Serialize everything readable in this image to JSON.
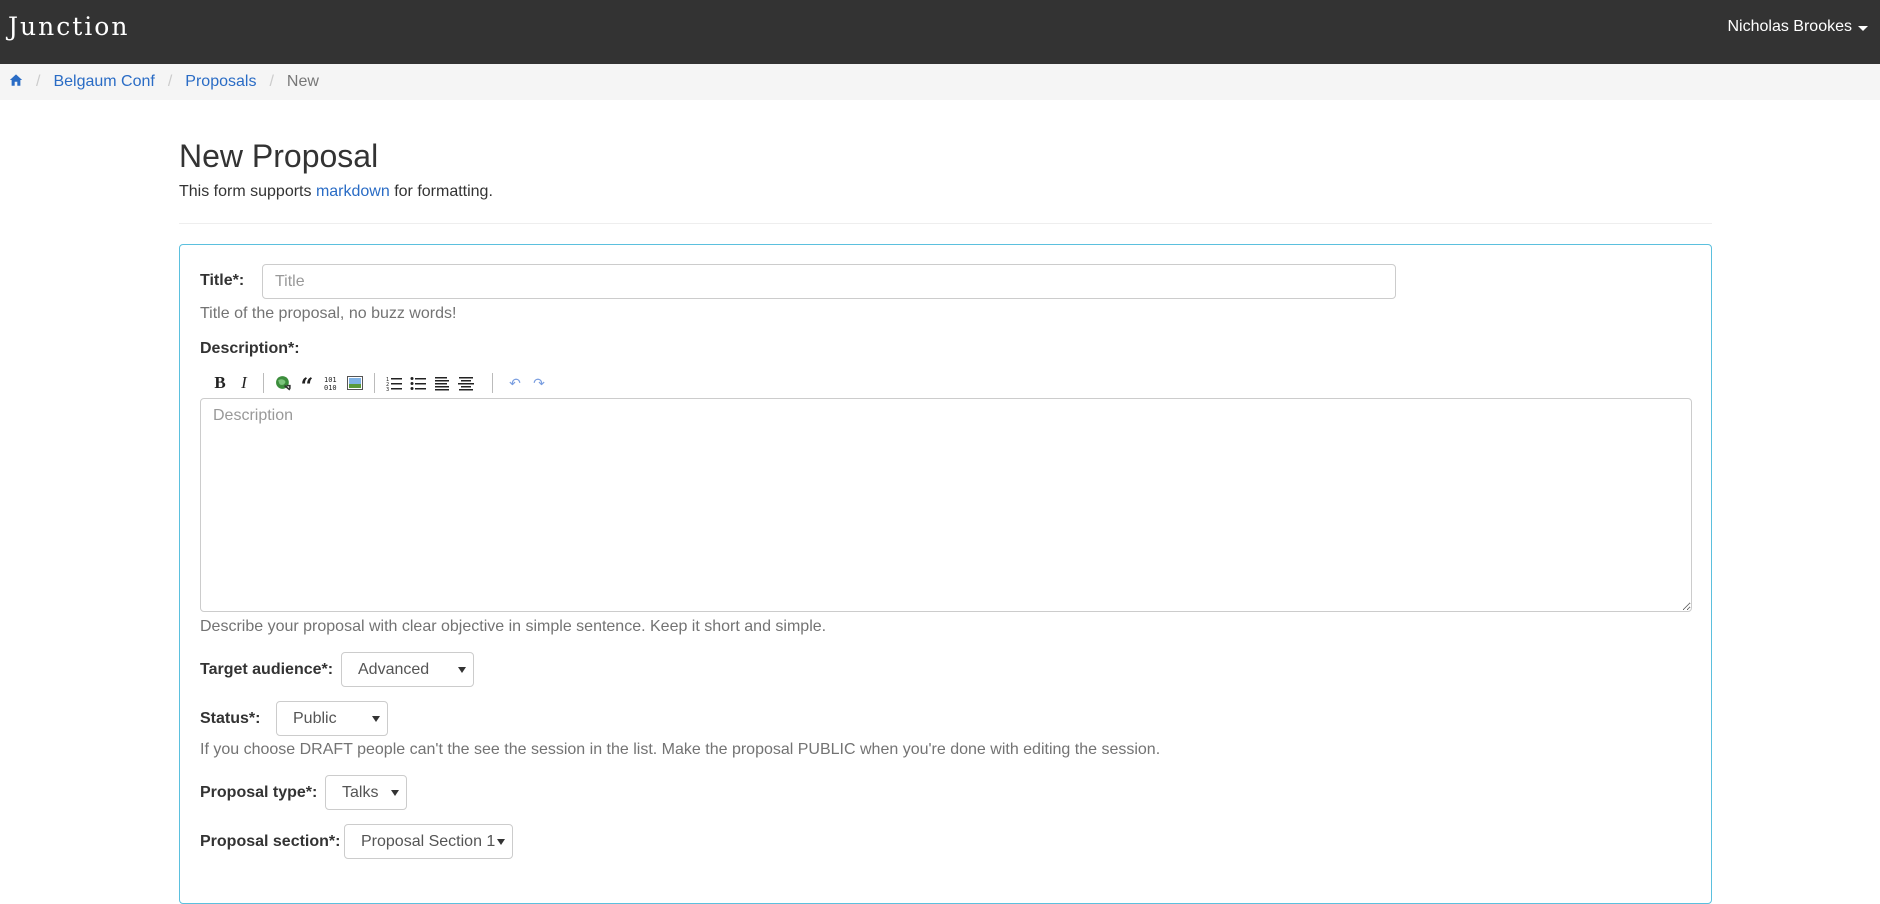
{
  "nav": {
    "brand": "Junction",
    "user_name": "Nicholas Brookes"
  },
  "breadcrumb": {
    "home_icon": "home-icon",
    "items": [
      "Belgaum Conf",
      "Proposals"
    ],
    "active": "New"
  },
  "header": {
    "title": "New Proposal",
    "sub_prefix": "This form supports ",
    "sub_link": "markdown",
    "sub_suffix": " for formatting."
  },
  "form": {
    "title_label": "Title*:",
    "title_placeholder": "Title",
    "title_help": "Title of the proposal, no buzz words!",
    "description_label": "Description*:",
    "description_placeholder": "Description",
    "description_help": "Describe your proposal with clear objective in simple sentence. Keep it short and simple.",
    "toolbar": {
      "bold": "B",
      "italic": "I",
      "link_icon": "link-icon",
      "quote": "“",
      "code": "101\n010",
      "image_icon": "image-icon",
      "ordered_list_icon": "ordered-list-icon",
      "unordered_list_icon": "unordered-list-icon",
      "heading_icon": "heading-icon",
      "hr_icon": "horizontal-rule-icon",
      "undo": "↶",
      "redo": "↷"
    },
    "target_audience_label": "Target audience*:",
    "target_audience_value": "Advanced",
    "status_label": "Status*:",
    "status_value": "Public",
    "status_help": "If you choose DRAFT people can't the see the session in the list. Make the proposal PUBLIC when you're done with editing the session.",
    "proposal_type_label": "Proposal type*:",
    "proposal_type_value": "Talks",
    "proposal_section_label": "Proposal section*:",
    "proposal_section_value": "Proposal Section 1"
  }
}
